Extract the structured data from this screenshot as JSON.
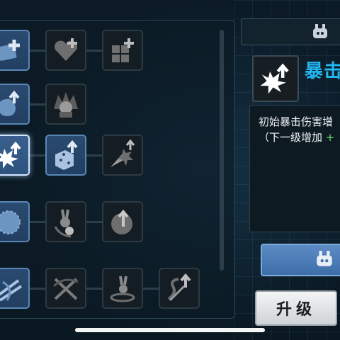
{
  "skill_panel": {
    "skill_name": "暴击",
    "description_line1": "初始暴击伤害增",
    "description_line2_prefix": "（下一级增加",
    "description_line2_value": "+"
  },
  "upgrade_button": {
    "label": "升级"
  },
  "colors": {
    "unlocked_node": "#2a4a70",
    "selected_node": "#3a5f8c",
    "locked_node": "#141d24",
    "skill_name": "#22b8f0",
    "highlight_green": "#5be36a"
  },
  "skill_tree": {
    "rows": [
      {
        "nodes": [
          {
            "icon": "card-plus-icon",
            "state": "unlocked"
          },
          {
            "icon": "heart-plus-icon",
            "state": "locked"
          },
          {
            "icon": "box-plus-icon",
            "state": "locked"
          }
        ]
      },
      {
        "nodes": [
          {
            "icon": "blob-up-icon",
            "state": "unlocked"
          },
          {
            "icon": "spiky-hair-head-icon",
            "state": "locked"
          }
        ]
      },
      {
        "nodes": [
          {
            "icon": "burst-up-icon",
            "state": "selected"
          },
          {
            "icon": "dice-up-icon",
            "state": "unlocked"
          },
          {
            "icon": "comet-up-icon",
            "state": "locked"
          }
        ]
      },
      {
        "nodes": [
          {
            "icon": "orb-icon",
            "state": "unlocked"
          },
          {
            "icon": "bunny-ball-icon",
            "state": "locked"
          },
          {
            "icon": "orb-up-icon",
            "state": "locked"
          }
        ]
      },
      {
        "nodes": [
          {
            "icon": "slash-swords-icon",
            "state": "unlocked"
          },
          {
            "icon": "crossed-blades-icon",
            "state": "locked"
          },
          {
            "icon": "bunny-swirl-icon",
            "state": "locked"
          },
          {
            "icon": "spin-up-icon",
            "state": "locked"
          }
        ]
      }
    ]
  },
  "badges": {
    "top_icon": "bunny-badge-icon",
    "bar_icon": "bunny-badge-icon"
  }
}
